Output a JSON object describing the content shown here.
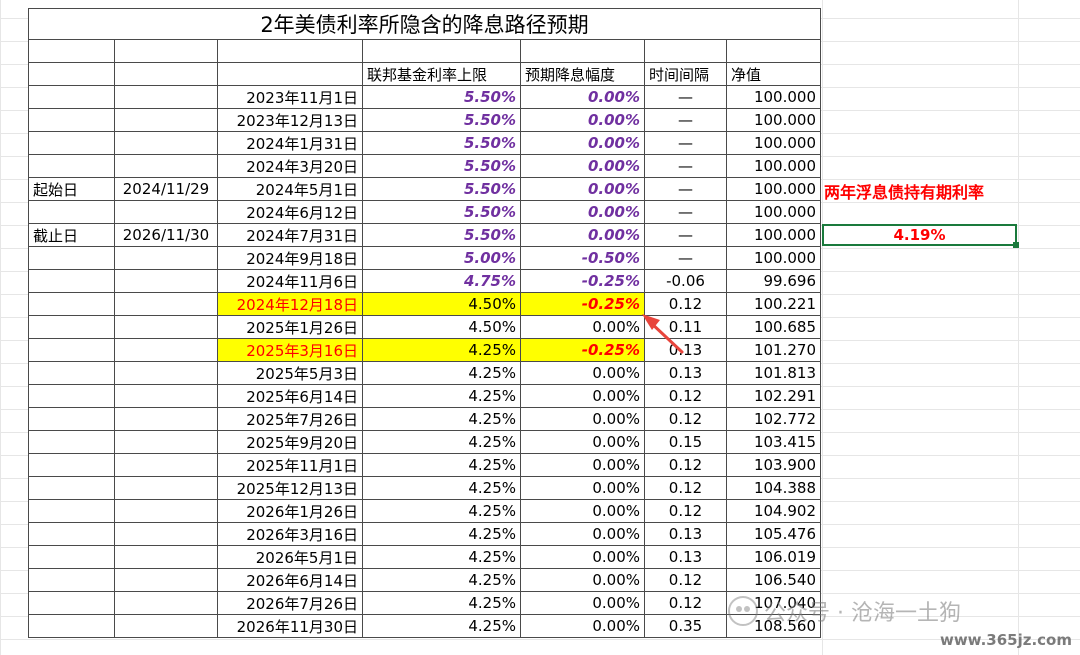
{
  "title": "2年美债利率所隐含的降息路径预期",
  "headers": {
    "rate_cap": "联邦基金利率上限",
    "expected_cut": "预期降息幅度",
    "interval": "时间间隔",
    "nav": "净值"
  },
  "start": {
    "label": "起始日",
    "date": "2024/11/29"
  },
  "end": {
    "label": "截止日",
    "date": "2026/11/30"
  },
  "rows": [
    {
      "date": "2023年11月1日",
      "rate": "5.50%",
      "cut": "0.00%",
      "interval": "—",
      "nav": "100.000"
    },
    {
      "date": "2023年12月13日",
      "rate": "5.50%",
      "cut": "0.00%",
      "interval": "—",
      "nav": "100.000"
    },
    {
      "date": "2024年1月31日",
      "rate": "5.50%",
      "cut": "0.00%",
      "interval": "—",
      "nav": "100.000"
    },
    {
      "date": "2024年3月20日",
      "rate": "5.50%",
      "cut": "0.00%",
      "interval": "—",
      "nav": "100.000"
    },
    {
      "date": "2024年5月1日",
      "rate": "5.50%",
      "cut": "0.00%",
      "interval": "—",
      "nav": "100.000"
    },
    {
      "date": "2024年6月12日",
      "rate": "5.50%",
      "cut": "0.00%",
      "interval": "—",
      "nav": "100.000"
    },
    {
      "date": "2024年7月31日",
      "rate": "5.50%",
      "cut": "0.00%",
      "interval": "—",
      "nav": "100.000"
    },
    {
      "date": "2024年9月18日",
      "rate": "5.00%",
      "cut": "-0.50%",
      "interval": "—",
      "nav": "100.000"
    },
    {
      "date": "2024年11月6日",
      "rate": "4.75%",
      "cut": "-0.25%",
      "interval": "-0.06",
      "nav": "99.696"
    },
    {
      "date": "2024年12月18日",
      "rate": "4.50%",
      "cut": "-0.25%",
      "interval": "0.12",
      "nav": "100.221"
    },
    {
      "date": "2025年1月26日",
      "rate": "4.50%",
      "cut": "0.00%",
      "interval": "0.11",
      "nav": "100.685"
    },
    {
      "date": "2025年3月16日",
      "rate": "4.25%",
      "cut": "-0.25%",
      "interval": "0.13",
      "nav": "101.270"
    },
    {
      "date": "2025年5月3日",
      "rate": "4.25%",
      "cut": "0.00%",
      "interval": "0.13",
      "nav": "101.813"
    },
    {
      "date": "2025年6月14日",
      "rate": "4.25%",
      "cut": "0.00%",
      "interval": "0.12",
      "nav": "102.291"
    },
    {
      "date": "2025年7月26日",
      "rate": "4.25%",
      "cut": "0.00%",
      "interval": "0.12",
      "nav": "102.772"
    },
    {
      "date": "2025年9月20日",
      "rate": "4.25%",
      "cut": "0.00%",
      "interval": "0.15",
      "nav": "103.415"
    },
    {
      "date": "2025年11月1日",
      "rate": "4.25%",
      "cut": "0.00%",
      "interval": "0.12",
      "nav": "103.900"
    },
    {
      "date": "2025年12月13日",
      "rate": "4.25%",
      "cut": "0.00%",
      "interval": "0.12",
      "nav": "104.388"
    },
    {
      "date": "2026年1月26日",
      "rate": "4.25%",
      "cut": "0.00%",
      "interval": "0.12",
      "nav": "104.902"
    },
    {
      "date": "2026年3月16日",
      "rate": "4.25%",
      "cut": "0.00%",
      "interval": "0.13",
      "nav": "105.476"
    },
    {
      "date": "2026年5月1日",
      "rate": "4.25%",
      "cut": "0.00%",
      "interval": "0.13",
      "nav": "106.019"
    },
    {
      "date": "2026年6月14日",
      "rate": "4.25%",
      "cut": "0.00%",
      "interval": "0.12",
      "nav": "106.540"
    },
    {
      "date": "2026年7月26日",
      "rate": "4.25%",
      "cut": "0.00%",
      "interval": "0.12",
      "nav": "107.040"
    },
    {
      "date": "2026年11月30日",
      "rate": "4.25%",
      "cut": "0.00%",
      "interval": "0.35",
      "nav": "108.560"
    }
  ],
  "side": {
    "label": "两年浮息债持有期利率",
    "value": "4.19%"
  },
  "watermark": {
    "text": "公众号 · 沧海一土狗",
    "site": "www.365jz.com"
  },
  "colors": {
    "purple": "#7030a0",
    "red": "#ff0000",
    "highlight": "#ffff00",
    "selection": "#1a7a3c"
  }
}
